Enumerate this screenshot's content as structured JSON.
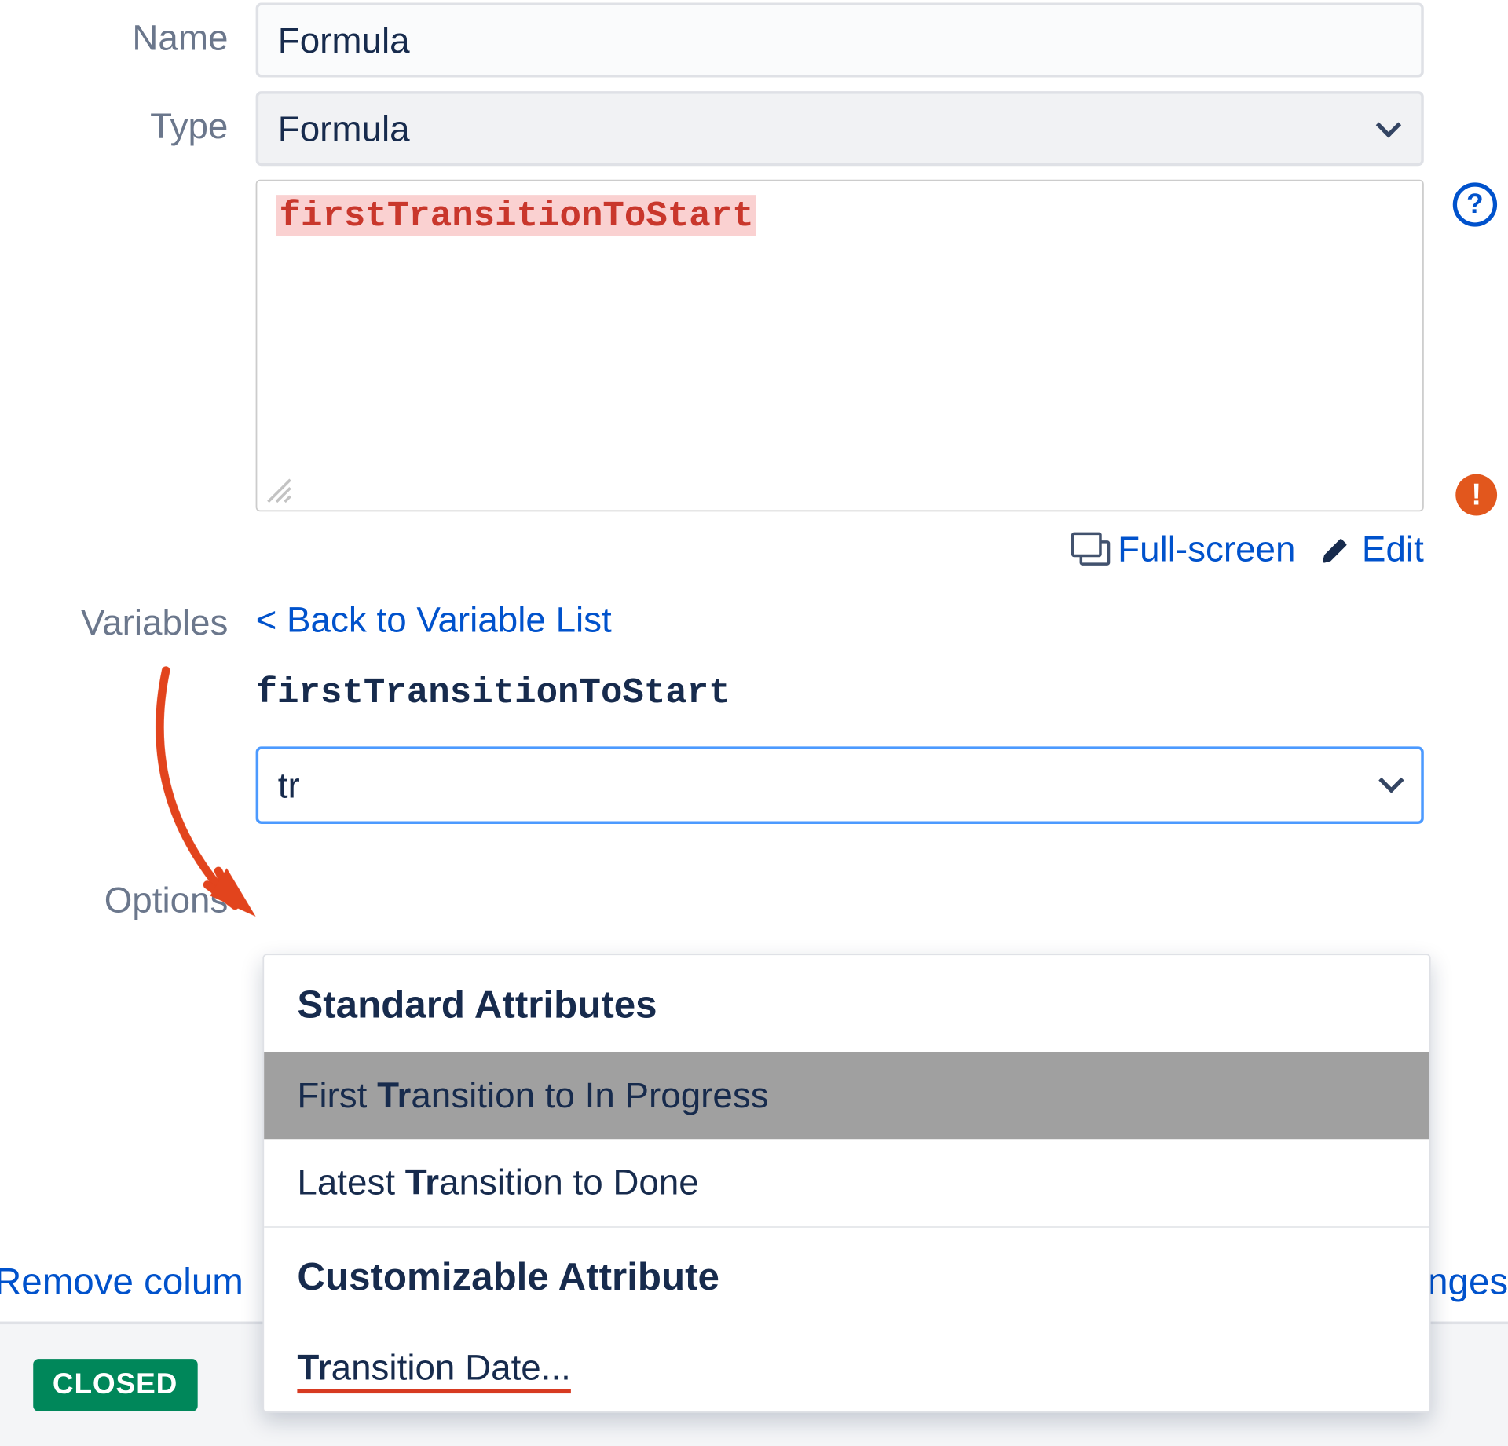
{
  "labels": {
    "name": "Name",
    "type": "Type",
    "variables": "Variables",
    "options": "Options"
  },
  "fields": {
    "name_value": "Formula",
    "type_value": "Formula"
  },
  "formula": {
    "content": "firstTransitionToStart"
  },
  "actions": {
    "fullscreen": "Full-screen",
    "edit": "Edit",
    "back_to_list": "< Back to Variable List"
  },
  "variable": {
    "name": "firstTransitionToStart",
    "search_value": "tr"
  },
  "dropdown": {
    "group1_header": "Standard Attributes",
    "item1_pre": "First ",
    "item1_match": "Tr",
    "item1_post": "ansition to In Progress",
    "item2_pre": "Latest ",
    "item2_match": "Tr",
    "item2_post": "ansition to Done",
    "group2_header": "Customizable Attribute",
    "item3_match": "Tr",
    "item3_post": "ansition Date..."
  },
  "footer": {
    "remove_column_fragment": "Remove colum",
    "changes_fragment": "nges",
    "status": "CLOSED"
  }
}
